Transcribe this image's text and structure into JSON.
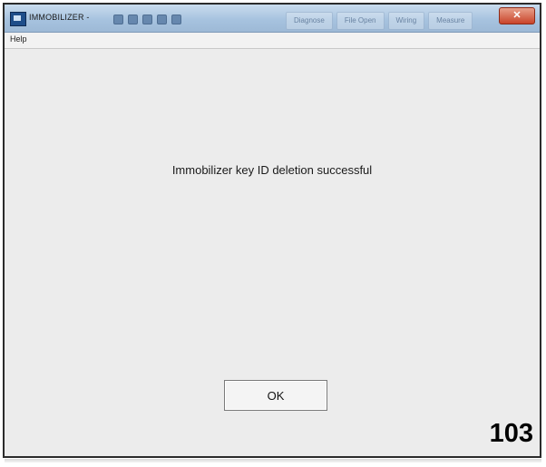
{
  "window": {
    "title": "IMMOBILIZER -",
    "close_label": "✕",
    "taskbar_tabs": [
      "Diagnose",
      "File Open",
      "Wiring",
      "Measure"
    ]
  },
  "menu": {
    "items": [
      "Help"
    ]
  },
  "dialog": {
    "message": "Immobilizer key ID deletion successful",
    "ok_label": "OK"
  },
  "page_number": "103"
}
